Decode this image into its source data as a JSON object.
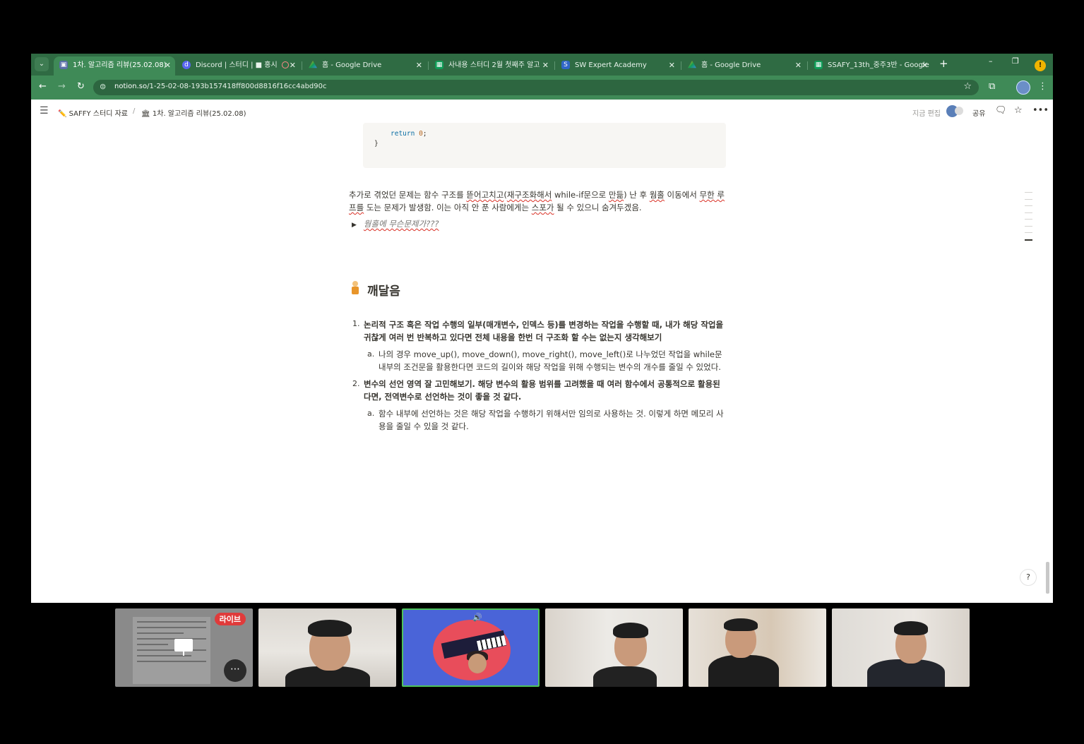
{
  "browser": {
    "tabs": [
      {
        "title": "1차. 알고리즘 리뷰(25.02.08)",
        "icon": "notion-icon"
      },
      {
        "title": "Discord | 스터디 | ",
        "icon": "discord-icon",
        "suffix": "■ 홍시"
      },
      {
        "title": "홈 - Google Drive",
        "icon": "google-drive-icon"
      },
      {
        "title": "사내용 스터디 2월 첫째주 알고",
        "icon": "google-sheets-icon"
      },
      {
        "title": "SW Expert Academy",
        "icon": "swea-icon"
      },
      {
        "title": "홈 - Google Drive",
        "icon": "google-drive-icon"
      },
      {
        "title": "SSAFY_13th_중주3반 - Google",
        "icon": "google-sheets-icon"
      }
    ],
    "new_tab": "+",
    "window_controls": [
      "–",
      "❐",
      "✕"
    ],
    "url_host": "notion.so",
    "url_path": "/1-25-02-08-193b157418ff800d8816f16cc4abd90c",
    "profile_badge": "!"
  },
  "notion": {
    "breadcrumb": [
      {
        "emoji": "✏️",
        "label": "SAFFY 스터디 자료"
      },
      {
        "emoji": "🏛",
        "label": "1차. 알고리즘 리뷰(25.02.08)"
      }
    ],
    "breadcrumb_sep": "/",
    "edited": "지금 편집",
    "share": "공유",
    "code": {
      "keyword": "return",
      "value": "0",
      "punct": ";",
      "close": "}"
    },
    "paragraph": {
      "p1": "추가로 겪었던 문제는 함수 구조를 ",
      "s1": "뜯어고치고",
      "p2": "(",
      "s2": "재구조화해서",
      "p3": " while-if문으로 ",
      "s3": "만듦",
      "p4": ") 난 후 ",
      "s4": "웜홀",
      "p5": " 이동에서 ",
      "s5": "무한 루프를",
      "p6": " 도는 문제가 발생함. 이는 아직 안 푼 사람에게는 ",
      "s6": "스포가",
      "p7": " 될 수 있으니 숨겨두겠음."
    },
    "toggle": {
      "arrow": "▶",
      "text": "웜홀에 무슨문제가???"
    },
    "heading": "깨달음",
    "list": [
      {
        "num": "1.",
        "text": "논리적 구조 혹은 작업 수행의 일부(매개변수, 인덱스 등)를 변경하는 작업을 수행할 때, 내가 해당 작업을 귀찮게 여러 번 반복하고 있다면 전체 내용을 한번 더 구조화 할 수는 없는지 생각해보기",
        "sub_letter": "a.",
        "sub_text": "나의 경우 move_up(), move_down(), move_right(), move_left()로 나누었던 작업을 while문 내부의 조건문을 활용한다면 코드의 길이와 해당 작업을 위해 수행되는 변수의 개수를 줄일 수 있었다."
      },
      {
        "num": "2.",
        "text": "변수의 선언 영역 잘 고민해보기. 해당 변수의 활용 범위를 고려했을 때 여러 함수에서 공통적으로 활용된다면, 전역변수로 선언하는 것이 좋을 것 같다.",
        "sub_letter": "a.",
        "sub_text": "함수 내부에 선언하는 것은 해당 작업을 수행하기 위해서만 임의로 사용하는 것. 이렇게 하면 메모리 사용을 줄일 수 있을 것 같다."
      }
    ]
  },
  "call": {
    "live_badge": "라이브",
    "more_label": "⋯",
    "volume_icon": "🔊"
  }
}
